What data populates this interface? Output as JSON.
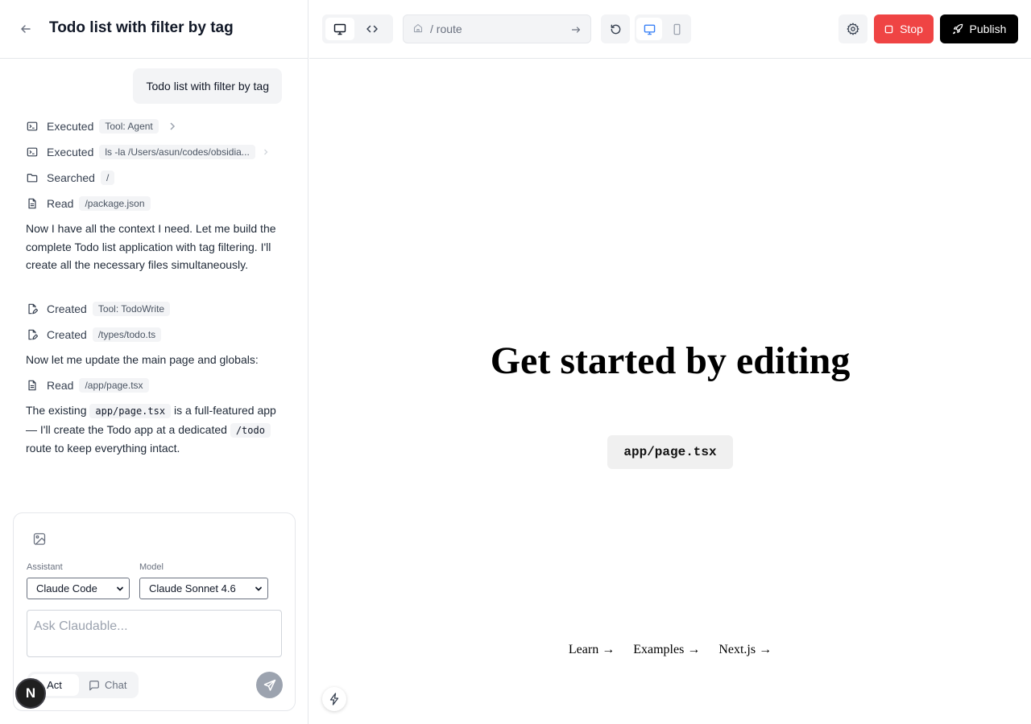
{
  "header": {
    "title": "Todo list with filter by tag"
  },
  "conversation": {
    "user_message": "Todo list with filter by tag",
    "steps": [
      {
        "icon": "terminal-icon",
        "verb": "Executed",
        "detail": "Tool: Agent"
      },
      {
        "icon": "terminal-icon",
        "verb": "Executed",
        "detail": "ls -la /Users/asun/codes/obsidia..."
      },
      {
        "icon": "folder-icon",
        "verb": "Searched",
        "detail": "/"
      },
      {
        "icon": "file-icon",
        "verb": "Read",
        "detail": "/package.json"
      }
    ],
    "message_1": "Now I have all the context I need. Let me build the complete Todo list application with tag filtering. I'll create all the necessary files simultaneously.",
    "steps_2": [
      {
        "icon": "file-edit-icon",
        "verb": "Created",
        "detail": "Tool: TodoWrite"
      },
      {
        "icon": "file-edit-icon",
        "verb": "Created",
        "detail": "/types/todo.ts"
      }
    ],
    "message_2": "Now let me update the main page and globals:",
    "steps_3": [
      {
        "icon": "file-icon",
        "verb": "Read",
        "detail": "/app/page.tsx"
      }
    ],
    "message_3": {
      "part1": "The existing ",
      "code1": "app/page.tsx",
      "part2": " is a full-featured app — I'll create the Todo app at a dedicated ",
      "code2": "/todo",
      "part3": " route to keep everything intact."
    }
  },
  "composer": {
    "assistant_label": "Assistant",
    "assistant_value": "Claude Code",
    "model_label": "Model",
    "model_value": "Claude Sonnet 4.6",
    "placeholder": "Ask Claudable...",
    "mode_act": "Act",
    "mode_chat": "Chat"
  },
  "badge": {
    "letter": "N"
  },
  "toolbar": {
    "route": "/ route",
    "stop_label": "Stop",
    "publish_label": "Publish"
  },
  "preview": {
    "heading": "Get started by editing",
    "file": "app/page.tsx",
    "links": [
      "Learn →",
      "Examples →",
      "Next.js →"
    ]
  },
  "colors": {
    "stop": "#ef4444",
    "publish": "#000000",
    "active_device": "#3b82f6"
  }
}
